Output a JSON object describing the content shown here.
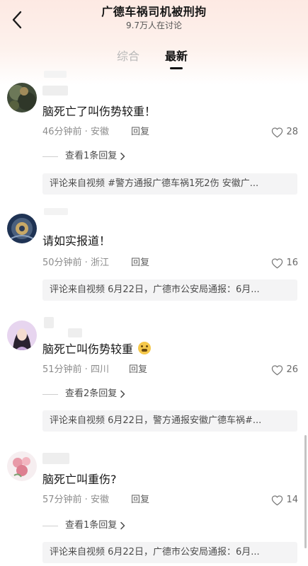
{
  "header": {
    "title": "广德车祸司机被刑拘",
    "subtitle": "9.7万人在讨论"
  },
  "tabs": [
    {
      "label": "综合",
      "active": false
    },
    {
      "label": "最新",
      "active": true
    }
  ],
  "comments": [
    {
      "text": "脑死亡了叫伤势较重！",
      "time_location": "46分钟前 · 安徽",
      "reply_label": "回复",
      "likes": "28",
      "view_replies": "查看1条回复",
      "source": "评论来自视频 #警方通报广德车祸1死2伤 安徽广..."
    },
    {
      "text": "请如实报道！",
      "time_location": "50分钟前 · 浙江",
      "reply_label": "回复",
      "likes": "16",
      "source": "评论来自视频 6月22日，广德市公安局通报：6月..."
    },
    {
      "text": "脑死亡叫伤势较重",
      "emoji": "😰",
      "time_location": "51分钟前 · 四川",
      "reply_label": "回复",
      "likes": "26",
      "view_replies": "查看2条回复",
      "source": "评论来自视频 6月22日，警方通报安徽广德车祸#..."
    },
    {
      "text": "脑死亡叫重伤?",
      "time_location": "57分钟前 · 安徽",
      "reply_label": "回复",
      "likes": "14",
      "view_replies": "查看1条回复",
      "source": "评论来自视频 6月22日，广德市公安局通报：6月..."
    }
  ],
  "icons": {
    "back": "chevron-left-icon",
    "like": "heart-outline-icon",
    "expand": "chevron-right-icon"
  },
  "colors": {
    "header_gradient_top": "#fde9e3",
    "text_primary": "#151515",
    "text_secondary": "#8c8c8c",
    "source_bg": "#f4f4f5"
  }
}
